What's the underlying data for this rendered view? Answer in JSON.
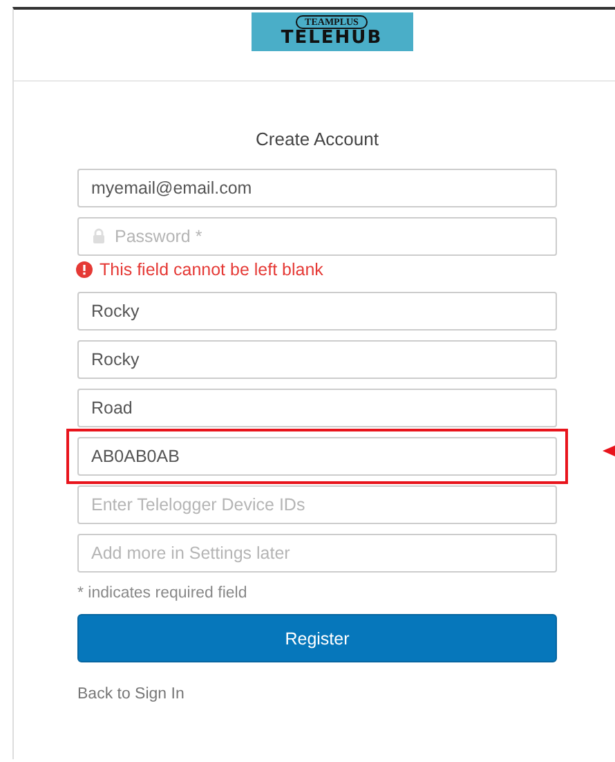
{
  "logo": {
    "top": "TEAMPLUS",
    "bottom": "TELEHUB"
  },
  "title": "Create Account",
  "fields": [
    {
      "value": "myemail@email.com",
      "highlighted": false
    },
    {
      "kind": "password",
      "placeholder": "Password *",
      "highlighted": false,
      "error": "This field cannot be left blank"
    },
    {
      "value": "Rocky",
      "highlighted": false
    },
    {
      "value": "Rocky",
      "highlighted": false
    },
    {
      "value": "Road",
      "highlighted": false
    },
    {
      "value": "AB0AB0AB",
      "highlighted": true
    },
    {
      "placeholder": "Enter Telelogger Device IDs",
      "highlighted": false
    },
    {
      "placeholder": "Add more in Settings later",
      "highlighted": false
    }
  ],
  "note": "* indicates required field",
  "button": "Register",
  "link": "Back to Sign In"
}
